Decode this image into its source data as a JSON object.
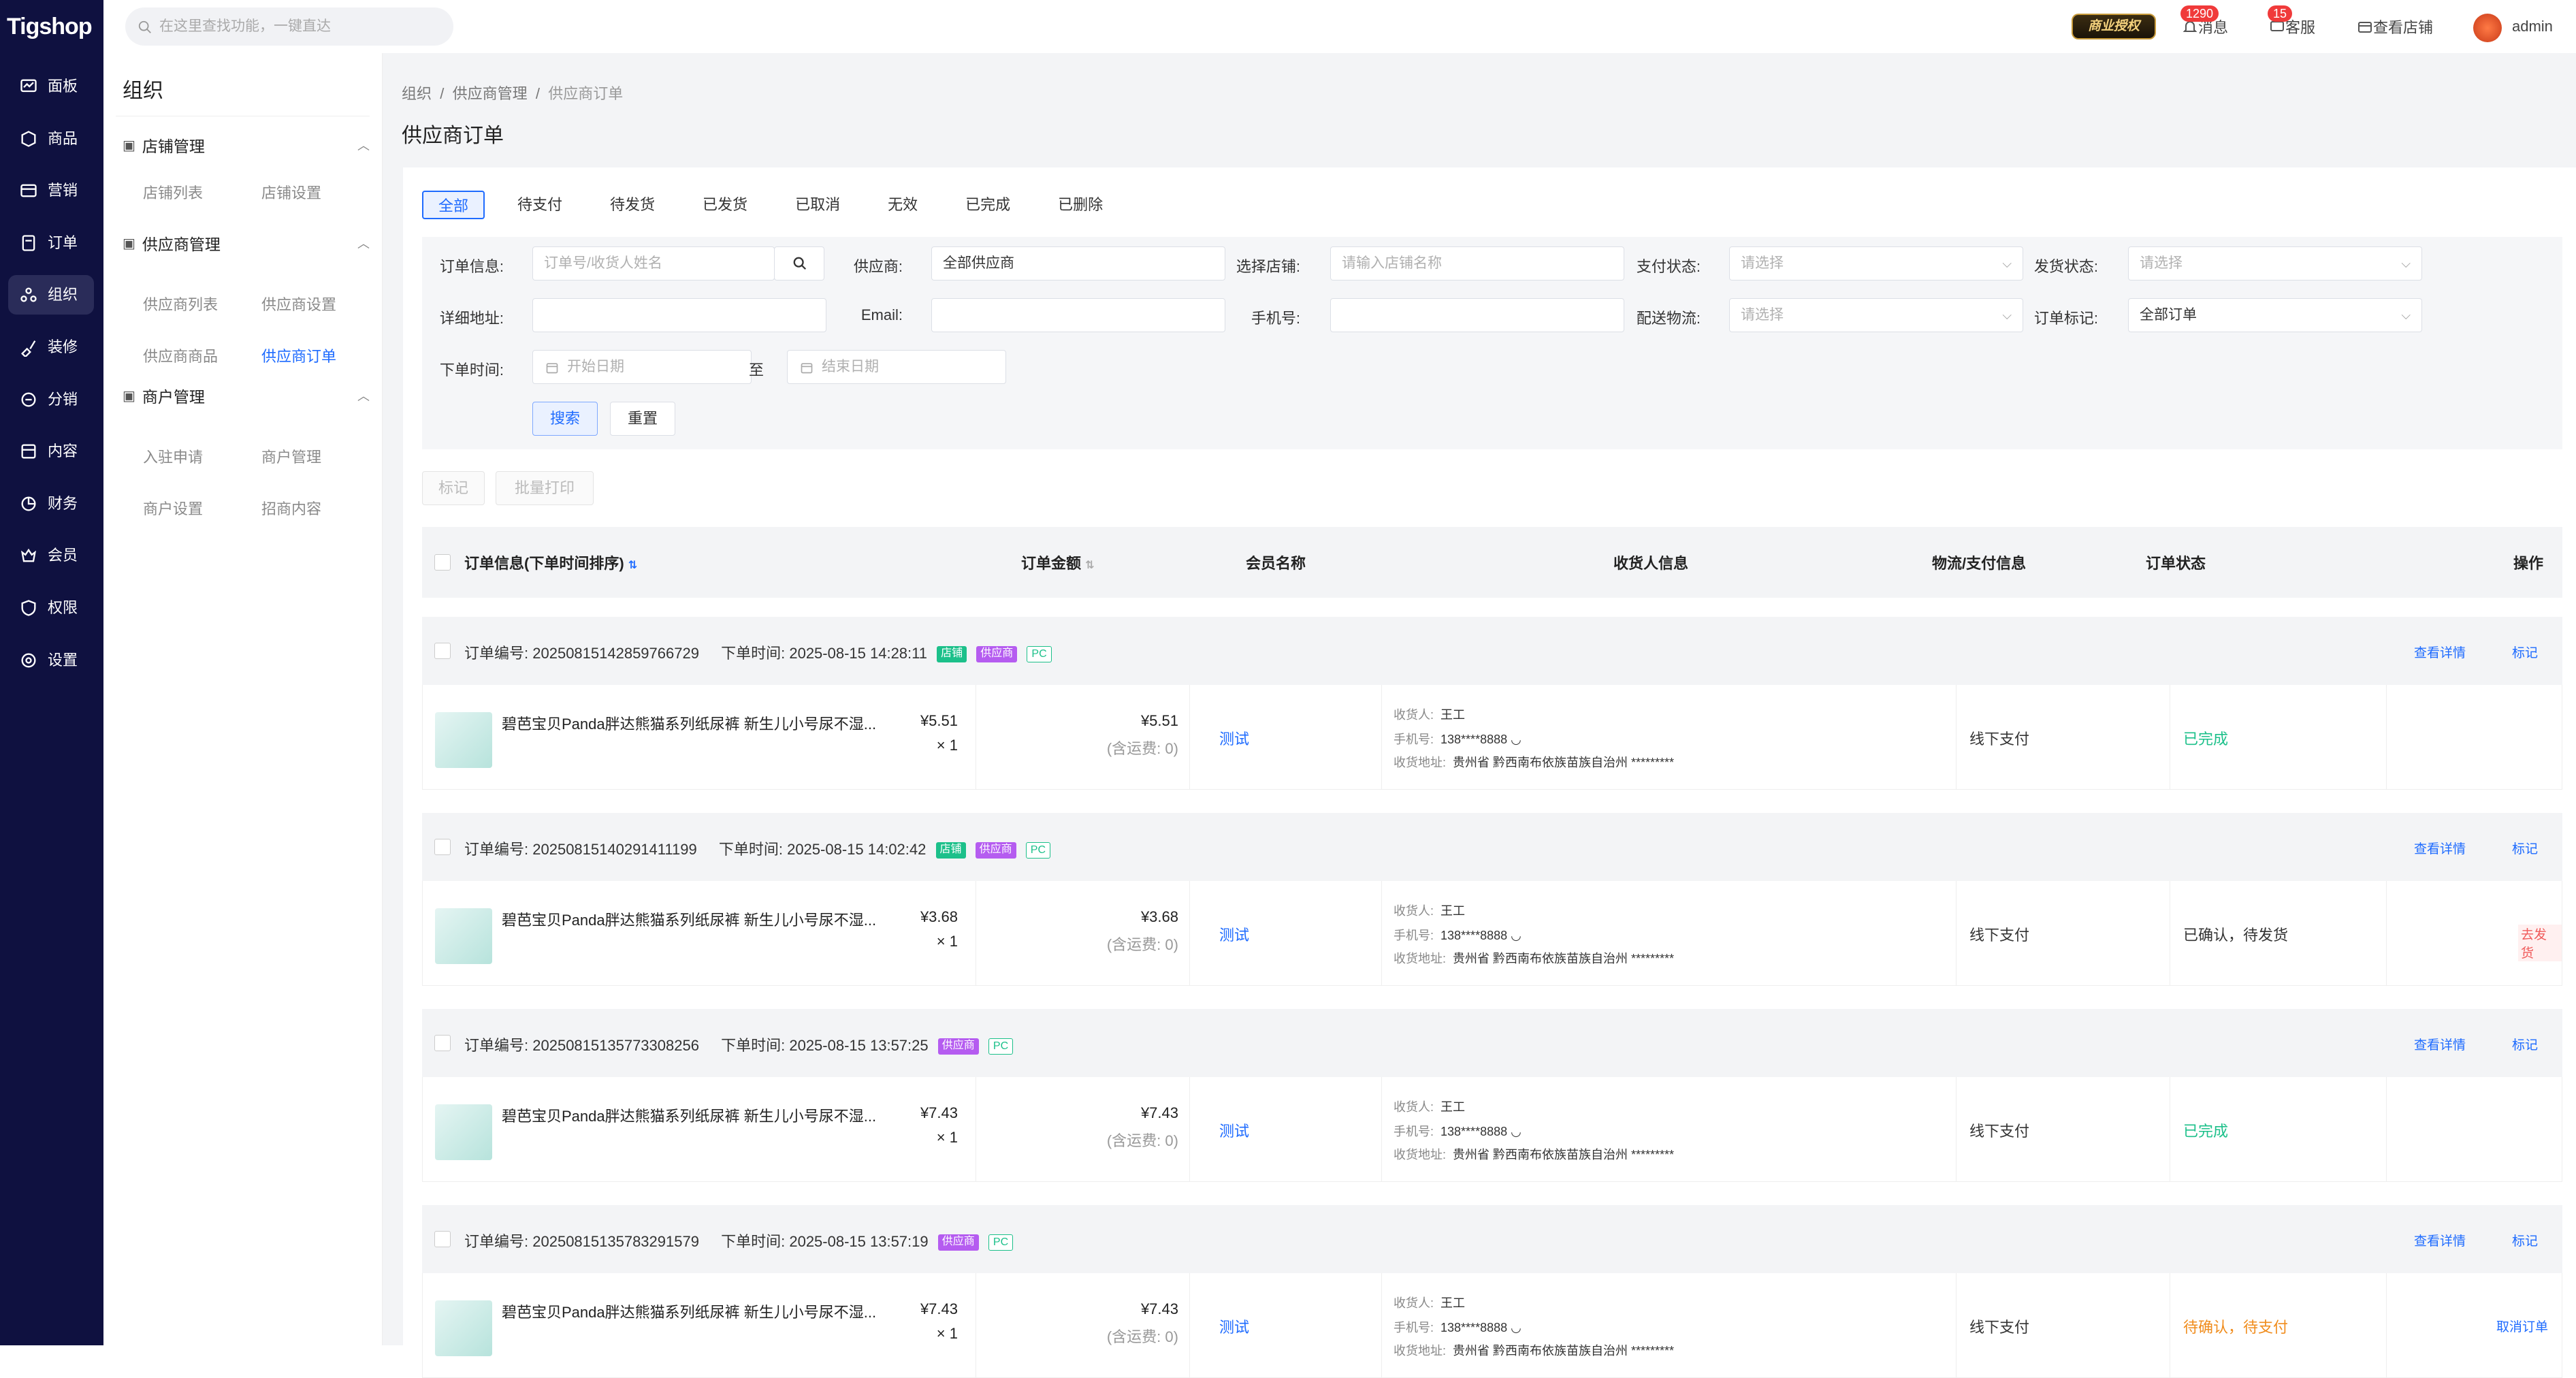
{
  "app": {
    "logo": "Tigshop"
  },
  "topbar": {
    "search_placeholder": "在这里查找功能，一键直达",
    "auth_badge": "商业授权",
    "messages": {
      "label": "消息",
      "count": "1290"
    },
    "service": {
      "label": "客服",
      "count": "15"
    },
    "view_store": "查看店铺",
    "user": "admin"
  },
  "sidebar": {
    "items": [
      {
        "label": "面板",
        "icon": "dashboard-icon"
      },
      {
        "label": "商品",
        "icon": "box-icon"
      },
      {
        "label": "营销",
        "icon": "marketing-icon"
      },
      {
        "label": "订单",
        "icon": "order-icon"
      },
      {
        "label": "组织",
        "icon": "organization-icon",
        "active": true
      },
      {
        "label": "装修",
        "icon": "brush-icon"
      },
      {
        "label": "分销",
        "icon": "distribution-icon"
      },
      {
        "label": "内容",
        "icon": "content-icon"
      },
      {
        "label": "财务",
        "icon": "finance-icon"
      },
      {
        "label": "会员",
        "icon": "member-icon"
      },
      {
        "label": "权限",
        "icon": "shield-icon"
      },
      {
        "label": "设置",
        "icon": "settings-icon"
      }
    ]
  },
  "submenu": {
    "title": "组织",
    "groups": [
      {
        "label": "店铺管理",
        "links": [
          "店铺列表",
          "店铺设置"
        ]
      },
      {
        "label": "供应商管理",
        "links": [
          "供应商列表",
          "供应商设置",
          "供应商商品",
          "供应商订单"
        ]
      },
      {
        "label": "商户管理",
        "links": [
          "入驻申请",
          "商户管理",
          "商户设置",
          "招商内容"
        ]
      }
    ]
  },
  "breadcrumb": [
    "组织",
    "供应商管理",
    "供应商订单"
  ],
  "page_title": "供应商订单",
  "tabs": [
    "全部",
    "待支付",
    "待发货",
    "已发货",
    "已取消",
    "无效",
    "已完成",
    "已删除"
  ],
  "filters": {
    "order_info": {
      "label": "订单信息:",
      "placeholder": "订单号/收货人姓名"
    },
    "supplier": {
      "label": "供应商:",
      "value": "全部供应商"
    },
    "store": {
      "label": "选择店铺:",
      "placeholder": "请输入店铺名称"
    },
    "pay_status": {
      "label": "支付状态:",
      "placeholder": "请选择"
    },
    "ship_status": {
      "label": "发货状态:",
      "placeholder": "请选择"
    },
    "address": {
      "label": "详细地址:"
    },
    "email": {
      "label": "Email:"
    },
    "phone": {
      "label": "手机号:"
    },
    "logistics": {
      "label": "配送物流:",
      "placeholder": "请选择"
    },
    "order_mark": {
      "label": "订单标记:",
      "value": "全部订单"
    },
    "order_time": {
      "label": "下单时间:",
      "start": "开始日期",
      "to": "至",
      "end": "结束日期"
    },
    "search_btn": "搜索",
    "reset_btn": "重置"
  },
  "bulk": {
    "mark": "标记",
    "print": "批量打印"
  },
  "table_headers": {
    "order_info": "订单信息(下单时间排序)",
    "amount": "订单金额",
    "member": "会员名称",
    "receiver": "收货人信息",
    "logistics": "物流/支付信息",
    "status": "订单状态",
    "ops": "操作"
  },
  "labels": {
    "order_no": "订单编号:",
    "order_time": "下单时间:",
    "tag_store": "店铺",
    "tag_supplier": "供应商",
    "tag_pc": "PC",
    "view_detail": "查看详情",
    "mark": "标记",
    "receiver": "收货人:",
    "phone": "手机号:",
    "address": "收货地址:",
    "shipping_prefix": "(含运费:",
    "shipping_suffix": ")"
  },
  "orders": [
    {
      "no": "20250815142859766729",
      "time": "2025-08-15 14:28:11",
      "store_tag": true,
      "product": "碧芭宝贝Panda胖达熊猫系列纸尿裤 新生儿小号尿不湿...",
      "unit_price": "¥5.51",
      "qty": "× 1",
      "total": "¥5.51",
      "shipping": "0",
      "member": "测试",
      "receiver": "王工",
      "phone": "138****8888",
      "address": "贵州省 黔西南布依族苗族自治州 *********",
      "pay": "线下支付",
      "status": "已完成",
      "status_color": "#1cc08a",
      "action": ""
    },
    {
      "no": "20250815140291411199",
      "time": "2025-08-15 14:02:42",
      "store_tag": true,
      "product": "碧芭宝贝Panda胖达熊猫系列纸尿裤 新生儿小号尿不湿...",
      "unit_price": "¥3.68",
      "qty": "× 1",
      "total": "¥3.68",
      "shipping": "0",
      "member": "测试",
      "receiver": "王工",
      "phone": "138****8888",
      "address": "贵州省 黔西南布依族苗族自治州 *********",
      "pay": "线下支付",
      "status": "已确认，待发货",
      "status_color": "#333333",
      "action": "去发货"
    },
    {
      "no": "20250815135773308256",
      "time": "2025-08-15 13:57:25",
      "store_tag": false,
      "product": "碧芭宝贝Panda胖达熊猫系列纸尿裤 新生儿小号尿不湿...",
      "unit_price": "¥7.43",
      "qty": "× 1",
      "total": "¥7.43",
      "shipping": "0",
      "member": "测试",
      "receiver": "王工",
      "phone": "138****8888",
      "address": "贵州省 黔西南布依族苗族自治州 *********",
      "pay": "线下支付",
      "status": "已完成",
      "status_color": "#1cc08a",
      "action": ""
    },
    {
      "no": "20250815135783291579",
      "time": "2025-08-15 13:57:19",
      "store_tag": false,
      "product": "碧芭宝贝Panda胖达熊猫系列纸尿裤 新生儿小号尿不湿...",
      "unit_price": "¥7.43",
      "qty": "× 1",
      "total": "¥7.43",
      "shipping": "0",
      "member": "测试",
      "receiver": "王工",
      "phone": "138****8888",
      "address": "贵州省 黔西南布依族苗族自治州 *********",
      "pay": "线下支付",
      "status": "待确认，待支付",
      "status_color": "#f08c1c",
      "action": "取消订单"
    }
  ]
}
